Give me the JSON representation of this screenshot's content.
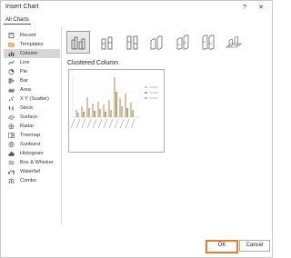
{
  "dialog": {
    "title": "Insert Chart",
    "help_glyph": "?",
    "close_glyph": "✕"
  },
  "tabs": [
    {
      "label": "All Charts"
    }
  ],
  "sidebar": {
    "items": [
      {
        "label": "Recent",
        "icon": "recent-icon"
      },
      {
        "label": "Templates",
        "icon": "folder-icon"
      },
      {
        "label": "Column",
        "icon": "column-chart-icon",
        "selected": true
      },
      {
        "label": "Line",
        "icon": "line-chart-icon"
      },
      {
        "label": "Pie",
        "icon": "pie-chart-icon"
      },
      {
        "label": "Bar",
        "icon": "bar-chart-icon"
      },
      {
        "label": "Area",
        "icon": "area-chart-icon"
      },
      {
        "label": "X Y (Scatter)",
        "icon": "scatter-chart-icon"
      },
      {
        "label": "Stock",
        "icon": "stock-chart-icon"
      },
      {
        "label": "Surface",
        "icon": "surface-chart-icon"
      },
      {
        "label": "Radar",
        "icon": "radar-chart-icon"
      },
      {
        "label": "Treemap",
        "icon": "treemap-chart-icon"
      },
      {
        "label": "Sunburst",
        "icon": "sunburst-chart-icon"
      },
      {
        "label": "Histogram",
        "icon": "histogram-chart-icon"
      },
      {
        "label": "Box & Whisker",
        "icon": "box-whisker-chart-icon"
      },
      {
        "label": "Waterfall",
        "icon": "waterfall-chart-icon"
      },
      {
        "label": "Combo",
        "icon": "combo-chart-icon"
      }
    ]
  },
  "subtypes": [
    {
      "name": "clustered-column",
      "selected": true
    },
    {
      "name": "stacked-column"
    },
    {
      "name": "100-stacked-column"
    },
    {
      "name": "3d-clustered-column"
    },
    {
      "name": "3d-stacked-column"
    },
    {
      "name": "3d-100-stacked-column"
    },
    {
      "name": "3d-column"
    }
  ],
  "selected_chart": {
    "title": "Clustered Column"
  },
  "footer": {
    "ok_label": "OK",
    "cancel_label": "Cancel"
  },
  "colors": {
    "accent_ok_border": "#e87b2c",
    "selected_item_bg": "#d6d6d6",
    "series_primary": "#d9c3a0",
    "series_secondary": "#c9a064",
    "series_tertiary": "#b8b8b8"
  }
}
